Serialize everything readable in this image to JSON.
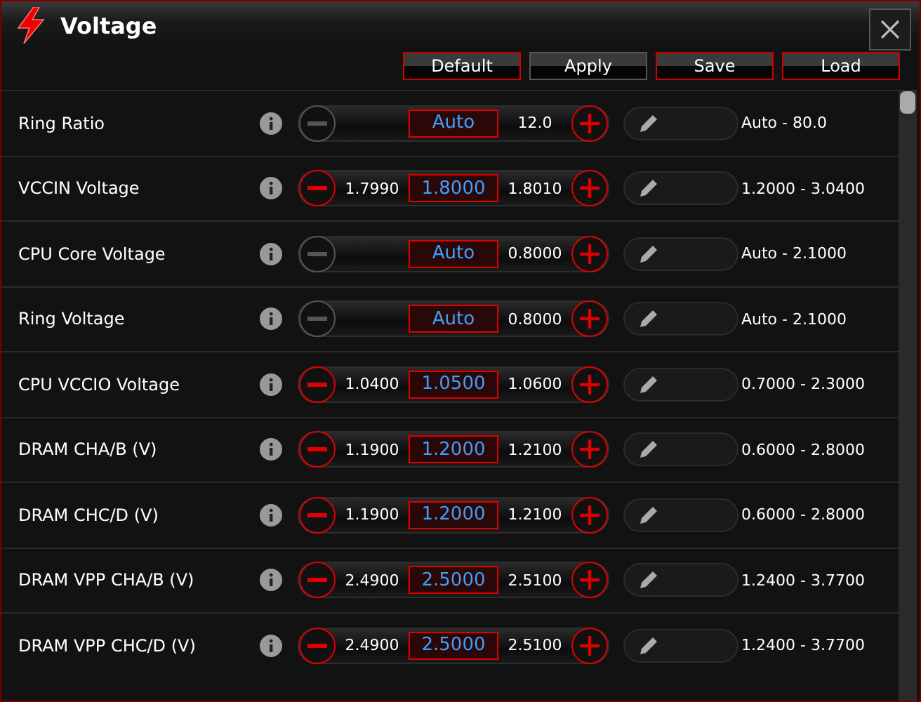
{
  "window": {
    "title": "Voltage"
  },
  "buttons": [
    {
      "label": "Default",
      "highlighted": true
    },
    {
      "label": "Apply",
      "highlighted": false
    },
    {
      "label": "Save",
      "highlighted": true
    },
    {
      "label": "Load",
      "highlighted": true
    }
  ],
  "rows": [
    {
      "label": "Ring Ratio",
      "minus_enabled": false,
      "value": "Auto",
      "upper": "12.0",
      "range": "Auto - 80.0"
    },
    {
      "label": "VCCIN Voltage",
      "minus_enabled": true,
      "lower": "1.7990",
      "value": "1.8000",
      "upper": "1.8010",
      "range": "1.2000 - 3.0400"
    },
    {
      "label": "CPU Core Voltage",
      "minus_enabled": false,
      "value": "Auto",
      "upper": "0.8000",
      "range": "Auto - 2.1000"
    },
    {
      "label": "Ring Voltage",
      "minus_enabled": false,
      "value": "Auto",
      "upper": "0.8000",
      "range": "Auto - 2.1000"
    },
    {
      "label": "CPU VCCIO Voltage",
      "minus_enabled": true,
      "lower": "1.0400",
      "value": "1.0500",
      "upper": "1.0600",
      "range": "0.7000 - 2.3000"
    },
    {
      "label": "DRAM CHA/B (V)",
      "minus_enabled": true,
      "lower": "1.1900",
      "value": "1.2000",
      "upper": "1.2100",
      "range": "0.6000 - 2.8000"
    },
    {
      "label": "DRAM CHC/D (V)",
      "minus_enabled": true,
      "lower": "1.1900",
      "value": "1.2000",
      "upper": "1.2100",
      "range": "0.6000 - 2.8000"
    },
    {
      "label": "DRAM VPP CHA/B (V)",
      "minus_enabled": true,
      "lower": "2.4900",
      "value": "2.5000",
      "upper": "2.5100",
      "range": "1.2400 - 3.7700"
    },
    {
      "label": "DRAM VPP CHC/D (V)",
      "minus_enabled": true,
      "lower": "2.4900",
      "value": "2.5000",
      "upper": "2.5100",
      "range": "1.2400 - 3.7700"
    }
  ]
}
